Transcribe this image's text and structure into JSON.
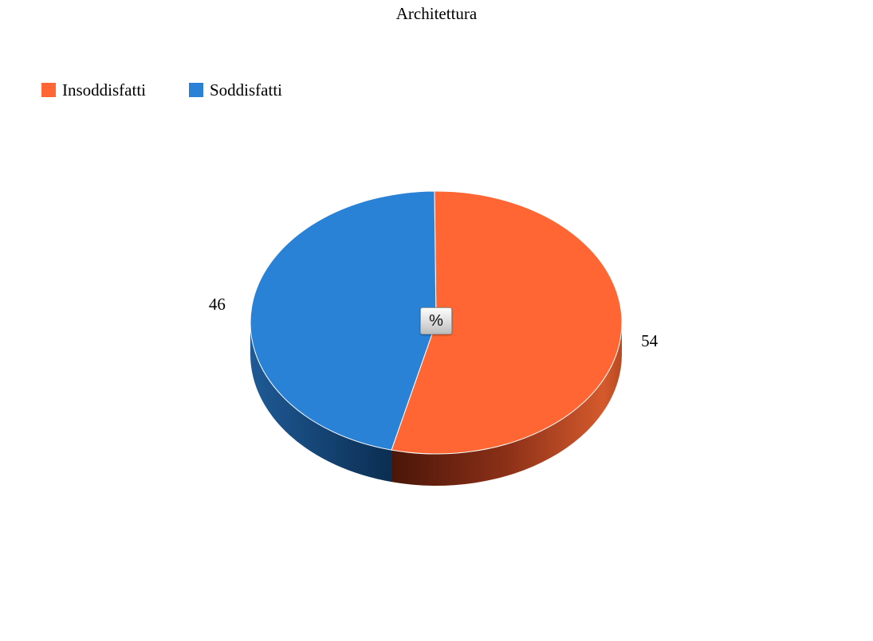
{
  "chart_data": {
    "type": "pie",
    "title": "Architettura",
    "categories": [
      "Insoddisfatti",
      "Soddisfatti"
    ],
    "values": [
      54,
      46
    ],
    "data_labels": [
      "54",
      "46"
    ],
    "colors": [
      "#FF6633",
      "#2A82D6"
    ],
    "legend_placement": "top-left",
    "style": "3d"
  },
  "controls": {
    "percent_button_label": "%"
  }
}
